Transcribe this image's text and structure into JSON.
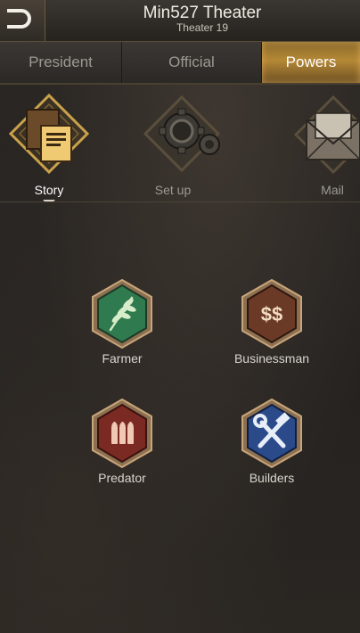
{
  "header": {
    "title": "Min527 Theater",
    "subtitle": "Theater 19"
  },
  "tabs": [
    {
      "label": "President"
    },
    {
      "label": "Official"
    },
    {
      "label": "Powers",
      "selected": true
    }
  ],
  "top_items": [
    {
      "label": "Story",
      "icon": "document-icon",
      "selected": true
    },
    {
      "label": "Set up",
      "icon": "gear-icon"
    },
    {
      "label": "Mail",
      "icon": "envelope-icon"
    }
  ],
  "roles": [
    {
      "label": "Farmer",
      "icon": "wheat-icon",
      "color": "#2f7a4e"
    },
    {
      "label": "Businessman",
      "icon": "dollar-icon",
      "color": "#6b3a26"
    },
    {
      "label": "Predator",
      "icon": "bullets-icon",
      "color": "#7a2a22"
    },
    {
      "label": "Builders",
      "icon": "tools-icon",
      "color": "#2a4a8a"
    }
  ],
  "colors": {
    "accent_gold": "#c9a24a",
    "selected_tab": "#b58836"
  }
}
